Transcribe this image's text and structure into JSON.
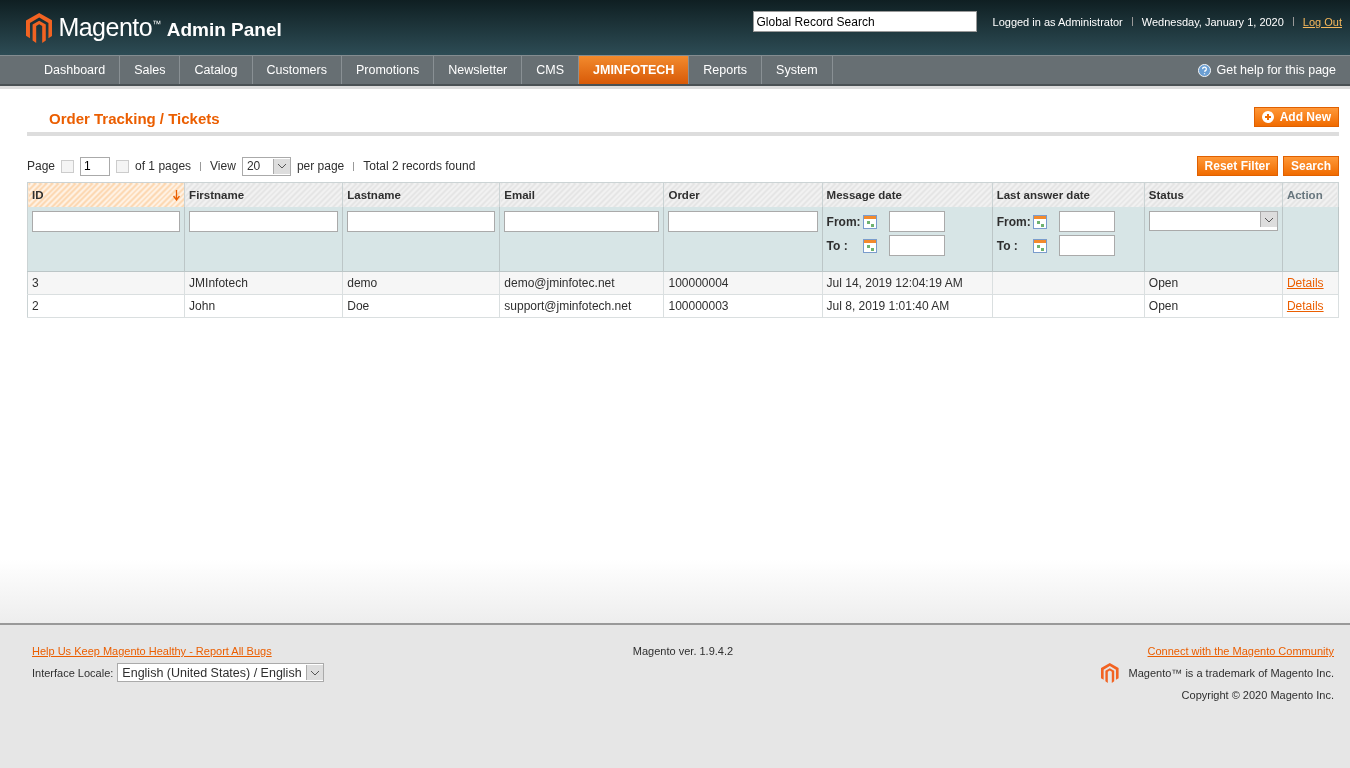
{
  "header": {
    "logo_text": "Magento$^{™}$",
    "product": "Admin Panel",
    "search_value": "Global Record Search",
    "user": "Logged in as Administrator",
    "date": "Wednesday, January 1, 2020",
    "logout": "Log Out"
  },
  "nav": [
    {
      "label": "Dashboard",
      "selected": false
    },
    {
      "label": "Sales",
      "selected": false
    },
    {
      "label": "Catalog",
      "selected": false
    },
    {
      "label": "Customers",
      "selected": false
    },
    {
      "label": "Promotions",
      "selected": false
    },
    {
      "label": "Newsletter",
      "selected": false
    },
    {
      "label": "CMS",
      "selected": false
    },
    {
      "label": "JMINFOTECH",
      "selected": true
    },
    {
      "label": "Reports",
      "selected": false
    },
    {
      "label": "System",
      "selected": false
    }
  ],
  "help": "Get help for this page",
  "page_title": "Order Tracking / Tickets",
  "add_button": "Add New",
  "pager": {
    "page_label": "Page",
    "page": "1",
    "of_pages": "of 1 pages",
    "view_label": "View",
    "per_page": "20",
    "per_page_label": "per page",
    "total": "Total 2 records found"
  },
  "filter_buttons": [
    "Reset Filter",
    "Search"
  ],
  "table": {
    "columns": [
      {
        "label": "ID",
        "kind": "text",
        "sorted": true,
        "sortable": true
      },
      {
        "label": "Firstname",
        "kind": "text",
        "sorted": false,
        "sortable": true
      },
      {
        "label": "Lastname",
        "kind": "text",
        "sorted": false,
        "sortable": true
      },
      {
        "label": "Email",
        "kind": "text",
        "sorted": false,
        "sortable": true
      },
      {
        "label": "Order",
        "kind": "text",
        "sorted": false,
        "sortable": true
      },
      {
        "label": "Message date",
        "kind": "date",
        "sorted": false,
        "sortable": true,
        "from": "From:",
        "to": "To :"
      },
      {
        "label": "Last answer date",
        "kind": "date",
        "sorted": false,
        "sortable": true,
        "from": "From:",
        "to": "To :"
      },
      {
        "label": "Status",
        "kind": "select",
        "sorted": false,
        "sortable": true
      },
      {
        "label": "Action",
        "kind": "none",
        "sorted": false,
        "sortable": false
      }
    ],
    "rows": [
      [
        "3",
        "JMInfotech",
        "demo",
        "demo@jminfotec.net",
        "100000004",
        "Jul 14, 2019 12:04:19 AM",
        "",
        "Open",
        "Details"
      ],
      [
        "2",
        "John",
        "Doe",
        "support@jminfotech.net",
        "100000003",
        "Jul 8, 2019 1:01:40 AM",
        "",
        "Open",
        "Details"
      ]
    ]
  },
  "footer": {
    "bug_link": "Help Us Keep Magento Healthy - Report All Bugs",
    "locale_label": "Interface Locale:",
    "locale_value": "English (United States) / English",
    "version": "Magento ver. 1.9.4.2",
    "community_link": "Connect with the Magento Community",
    "trademark": "Magento™ is a trademark of Magento Inc.",
    "copyright": "Copyright © 2020 Magento Inc."
  }
}
